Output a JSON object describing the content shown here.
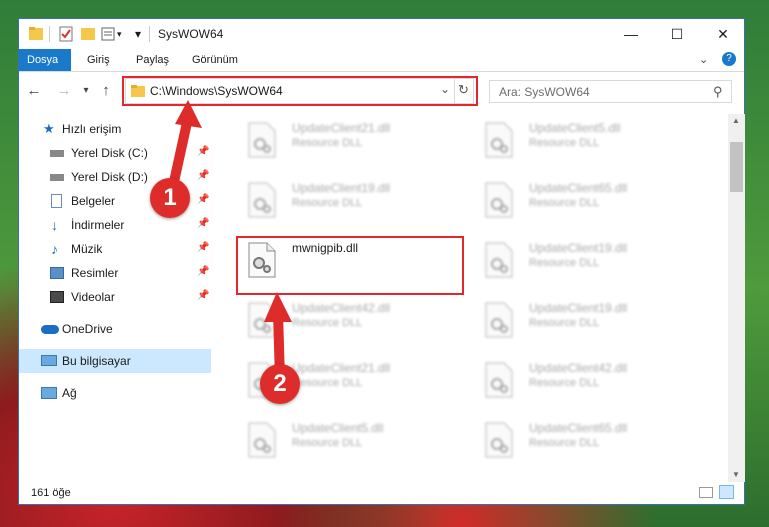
{
  "window": {
    "title": "SysWOW64",
    "controls": {
      "minimize": "—",
      "maximize": "☐",
      "close": "✕"
    }
  },
  "ribbon": {
    "tabs": [
      {
        "label": "Dosya",
        "active": true
      },
      {
        "label": "Giriş",
        "active": false
      },
      {
        "label": "Paylaş",
        "active": false
      },
      {
        "label": "Görünüm",
        "active": false
      }
    ]
  },
  "address": {
    "path": "C:\\Windows\\SysWOW64"
  },
  "search": {
    "placeholder": "Ara: SysWOW64"
  },
  "sidebar": {
    "items": [
      {
        "label": "Hızlı erişim",
        "icon": "star-icon",
        "pinned": false,
        "selected": false
      },
      {
        "label": "Yerel Disk (C:)",
        "icon": "drive-icon",
        "pinned": true,
        "selected": false
      },
      {
        "label": "Yerel Disk (D:)",
        "icon": "drive-icon",
        "pinned": true,
        "selected": false
      },
      {
        "label": "Belgeler",
        "icon": "documents-icon",
        "pinned": true,
        "selected": false
      },
      {
        "label": "İndirmeler",
        "icon": "download-icon",
        "pinned": true,
        "selected": false
      },
      {
        "label": "Müzik",
        "icon": "music-icon",
        "pinned": true,
        "selected": false
      },
      {
        "label": "Resimler",
        "icon": "pictures-icon",
        "pinned": true,
        "selected": false
      },
      {
        "label": "Videolar",
        "icon": "videos-icon",
        "pinned": true,
        "selected": false
      },
      {
        "label": "OneDrive",
        "icon": "onedrive-icon",
        "pinned": false,
        "selected": false
      },
      {
        "label": "Bu bilgisayar",
        "icon": "computer-icon",
        "pinned": false,
        "selected": true
      },
      {
        "label": "Ağ",
        "icon": "network-icon",
        "pinned": false,
        "selected": false
      }
    ]
  },
  "files": [
    {
      "name": "UpdateClient21.dll",
      "type": "Resource DLL",
      "blurred": true
    },
    {
      "name": "UpdateClient5.dll",
      "type": "Resource DLL",
      "blurred": true
    },
    {
      "name": "UpdateClient19.dll",
      "type": "Resource DLL",
      "blurred": true
    },
    {
      "name": "UpdateClient65.dll",
      "type": "Resource DLL",
      "blurred": true
    },
    {
      "name": "mwnigpib.dll",
      "type": "",
      "blurred": false
    },
    {
      "name": "UpdateClient19.dll",
      "type": "Resource DLL",
      "blurred": true
    },
    {
      "name": "UpdateClient42.dll",
      "type": "Resource DLL",
      "blurred": true
    },
    {
      "name": "UpdateClient19.dll",
      "type": "Resource DLL",
      "blurred": true
    },
    {
      "name": "UpdateClient21.dll",
      "type": "Resource DLL",
      "blurred": true
    },
    {
      "name": "UpdateClient42.dll",
      "type": "Resource DLL",
      "blurred": true
    },
    {
      "name": "UpdateClient5.dll",
      "type": "Resource DLL",
      "blurred": true
    },
    {
      "name": "UpdateClient65.dll",
      "type": "Resource DLL",
      "blurred": true
    },
    {
      "name": "",
      "type": "",
      "blurred": true
    },
    {
      "name": "",
      "type": "",
      "blurred": true
    }
  ],
  "status": {
    "count": "161 öğe"
  },
  "annotations": [
    {
      "label": "1"
    },
    {
      "label": "2"
    }
  ],
  "colors": {
    "accent": "#1979ca",
    "highlight": "#e2272d",
    "selection": "#cce8ff"
  }
}
